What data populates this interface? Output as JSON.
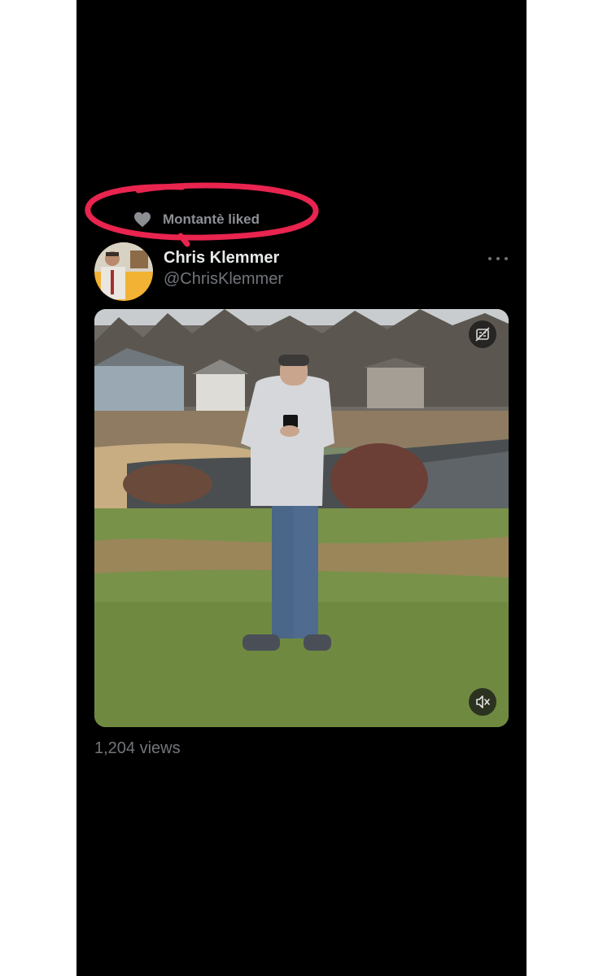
{
  "social_context": {
    "icon": "heart-icon",
    "text": "Montantè liked"
  },
  "annotation": {
    "color": "#e8244f"
  },
  "tweet": {
    "author_name": "Chris Klemmer",
    "author_handle": "@ChrisKlemmer",
    "more_icon": "more-horizontal-icon",
    "media": {
      "type": "video",
      "captions_icon": "captions-off-icon",
      "volume_icon": "volume-muted-icon"
    },
    "views": "1,204 views"
  },
  "colors": {
    "background": "#000000",
    "primary_text": "#e7e9ea",
    "secondary_text": "#71767b"
  }
}
